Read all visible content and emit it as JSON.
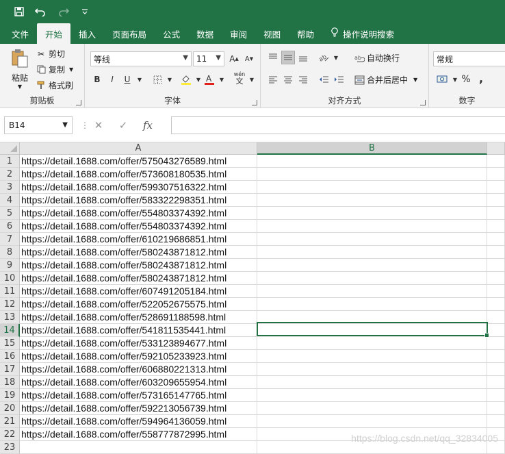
{
  "tabs": [
    {
      "label": "文件"
    },
    {
      "label": "开始"
    },
    {
      "label": "插入"
    },
    {
      "label": "页面布局"
    },
    {
      "label": "公式"
    },
    {
      "label": "数据"
    },
    {
      "label": "审阅"
    },
    {
      "label": "视图"
    },
    {
      "label": "帮助"
    },
    {
      "label": "操作说明搜索"
    }
  ],
  "ribbon": {
    "clipboard": {
      "paste": "粘贴",
      "cut": "剪切",
      "copy": "复制",
      "format_painter": "格式刷",
      "group": "剪贴板"
    },
    "font": {
      "name": "等线",
      "size": "11",
      "group": "字体"
    },
    "alignment": {
      "wrap": "自动换行",
      "merge": "合并后居中",
      "group": "对齐方式"
    },
    "number": {
      "format": "常规",
      "percent": "%",
      "comma": ",",
      "group": "数字"
    }
  },
  "formula_bar": {
    "name_box": "B14",
    "formula": ""
  },
  "columns": [
    "A",
    "B"
  ],
  "rows": [
    {
      "num": "1",
      "a": "https://detail.1688.com/offer/575043276589.html"
    },
    {
      "num": "2",
      "a": "https://detail.1688.com/offer/573608180535.html"
    },
    {
      "num": "3",
      "a": "https://detail.1688.com/offer/599307516322.html"
    },
    {
      "num": "4",
      "a": "https://detail.1688.com/offer/583322298351.html"
    },
    {
      "num": "5",
      "a": "https://detail.1688.com/offer/554803374392.html"
    },
    {
      "num": "6",
      "a": "https://detail.1688.com/offer/554803374392.html"
    },
    {
      "num": "7",
      "a": "https://detail.1688.com/offer/610219686851.html"
    },
    {
      "num": "8",
      "a": "https://detail.1688.com/offer/580243871812.html"
    },
    {
      "num": "9",
      "a": "https://detail.1688.com/offer/580243871812.html"
    },
    {
      "num": "10",
      "a": "https://detail.1688.com/offer/580243871812.html"
    },
    {
      "num": "11",
      "a": "https://detail.1688.com/offer/607491205184.html"
    },
    {
      "num": "12",
      "a": "https://detail.1688.com/offer/522052675575.html"
    },
    {
      "num": "13",
      "a": "https://detail.1688.com/offer/528691188598.html"
    },
    {
      "num": "14",
      "a": "https://detail.1688.com/offer/541811535441.html"
    },
    {
      "num": "15",
      "a": "https://detail.1688.com/offer/533123894677.html"
    },
    {
      "num": "16",
      "a": "https://detail.1688.com/offer/592105233923.html"
    },
    {
      "num": "17",
      "a": "https://detail.1688.com/offer/606880221313.html"
    },
    {
      "num": "18",
      "a": "https://detail.1688.com/offer/603209655954.html"
    },
    {
      "num": "19",
      "a": "https://detail.1688.com/offer/573165147765.html"
    },
    {
      "num": "20",
      "a": "https://detail.1688.com/offer/592213056739.html"
    },
    {
      "num": "21",
      "a": "https://detail.1688.com/offer/594964136059.html"
    },
    {
      "num": "22",
      "a": "https://detail.1688.com/offer/558777872995.html"
    },
    {
      "num": "23",
      "a": ""
    }
  ],
  "selected_row": "14",
  "watermark": "https://blog.csdn.net/qq_32834005",
  "colors": {
    "accent": "#217346"
  }
}
